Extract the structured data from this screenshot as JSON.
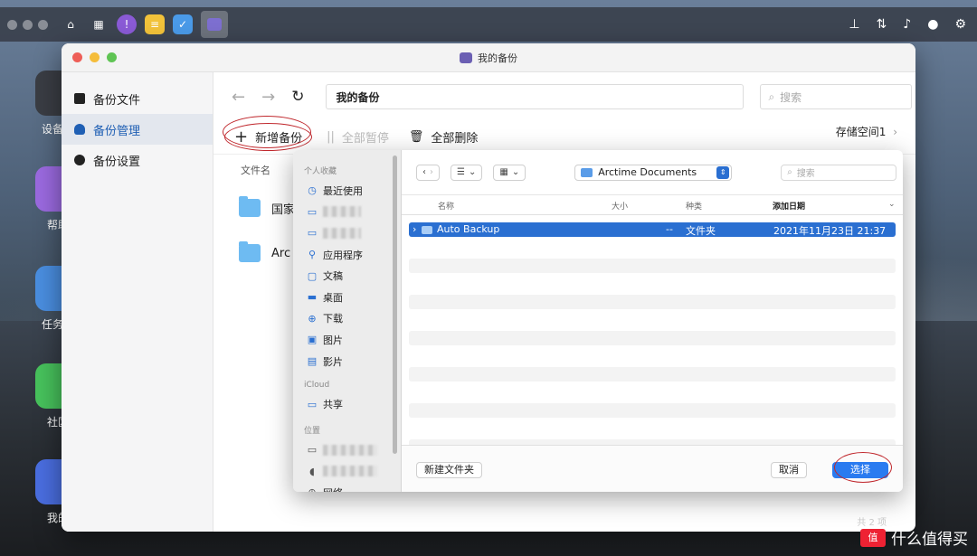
{
  "desktop": {
    "icons": [
      {
        "label": "设备管"
      },
      {
        "label": "帮助"
      },
      {
        "label": "任务管"
      },
      {
        "label": "社区"
      },
      {
        "label": "我的"
      }
    ]
  },
  "window": {
    "title": "我的备份",
    "sidebar": [
      {
        "label": "备份文件"
      },
      {
        "label": "备份管理"
      },
      {
        "label": "备份设置"
      }
    ],
    "path": "我的备份",
    "search_placeholder": "搜索",
    "actions": {
      "add": "新增备份",
      "pause_all": "全部暂停",
      "delete_all": "全部删除"
    },
    "storage": "存储空间1",
    "column_header": "文件名",
    "files": [
      {
        "name": "国家"
      },
      {
        "name": "Arc"
      }
    ],
    "footer_count": "共 2 项"
  },
  "dialog": {
    "sections": {
      "favorites": "个人收藏",
      "icloud": "iCloud",
      "locations": "位置"
    },
    "favorites": [
      {
        "label": "最近使用",
        "icon": "clock-icon"
      },
      {
        "label": "应用程序",
        "icon": "apps-icon"
      },
      {
        "label": "文稿",
        "icon": "doc-icon"
      },
      {
        "label": "桌面",
        "icon": "desktop-icon"
      },
      {
        "label": "下载",
        "icon": "download-icon"
      },
      {
        "label": "图片",
        "icon": "photo-icon"
      },
      {
        "label": "影片",
        "icon": "film-icon"
      }
    ],
    "icloud_items": [
      {
        "label": "共享"
      }
    ],
    "network_label": "网络",
    "location": "Arctime Documents",
    "search_placeholder": "搜索",
    "table_headers": {
      "name": "名称",
      "size": "大小",
      "kind": "种类",
      "date": "添加日期"
    },
    "selected_row": {
      "name": "Auto Backup",
      "size": "--",
      "kind": "文件夹",
      "date": "2021年11月23日 21:37"
    },
    "buttons": {
      "new_folder": "新建文件夹",
      "cancel": "取消",
      "choose": "选择"
    }
  },
  "watermark": {
    "badge": "值",
    "text": "什么值得买"
  }
}
